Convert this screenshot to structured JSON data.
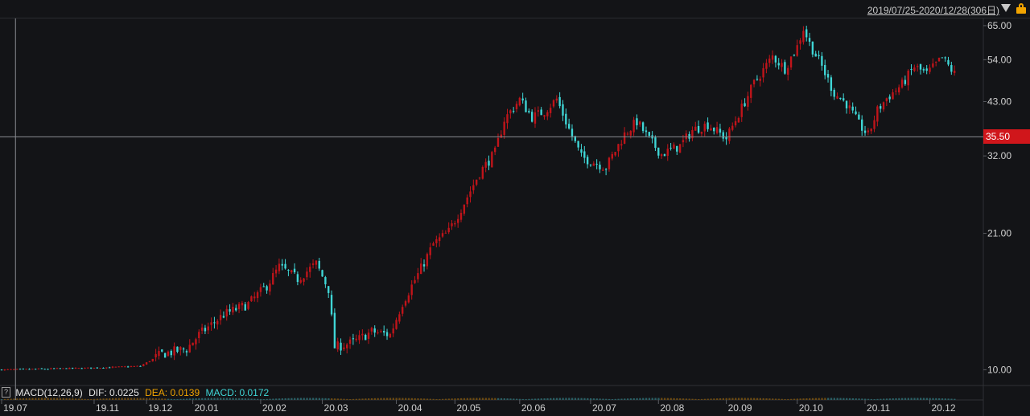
{
  "header": {
    "range_label": "2019/07/25-2020/12/28(306日)",
    "dropdown_icon": "triangle-down-icon",
    "lock_icon": "lock-icon"
  },
  "indicator": {
    "name": "MACD(12,26,9)",
    "dif_label": "DIF: 0.0225",
    "dea_label": "DEA: 0.0139",
    "macd_label": "MACD: 0.0172",
    "colors": {
      "dif": "#e6e6e6",
      "dea": "#f2a400",
      "macd": "#3fd6d6"
    }
  },
  "crosshair": {
    "price_label": "35.50",
    "price": 35.5,
    "date": "19.08"
  },
  "colors": {
    "up": "#c0141a",
    "down": "#3fd6d6",
    "axis_text": "#d0d0d0",
    "background": "#131417",
    "price_tag": "#d0161b"
  },
  "chart_data": {
    "type": "candlestick",
    "yscale": "log",
    "ylim": [
      9.3,
      67
    ],
    "yticks": [
      65.0,
      54.0,
      43.0,
      32.0,
      21.0,
      10.0
    ],
    "ytick_labels": [
      "65.00",
      "54.00",
      "43.00",
      "32.00",
      "21.00",
      "10.00"
    ],
    "xticks": [
      "19.07",
      "19.11",
      "19.12",
      "20.01",
      "20.02",
      "20.03",
      "20.04",
      "20.05",
      "20.06",
      "20.07",
      "20.08",
      "20.09",
      "20.10",
      "20.11",
      "20.12"
    ],
    "xtick_positions": [
      0,
      30,
      47,
      62,
      84,
      104,
      128,
      147,
      168,
      191,
      213,
      235,
      258,
      280,
      301
    ],
    "bars": 310,
    "price_path": [
      [
        0,
        10.0
      ],
      [
        30,
        10.1
      ],
      [
        45,
        10.2
      ],
      [
        52,
        10.9
      ],
      [
        60,
        11.2
      ],
      [
        64,
        12.1
      ],
      [
        72,
        13.5
      ],
      [
        80,
        14.3
      ],
      [
        86,
        15.8
      ],
      [
        90,
        17.5
      ],
      [
        96,
        16.4
      ],
      [
        102,
        17.8
      ],
      [
        106,
        15.5
      ],
      [
        108,
        11.3
      ],
      [
        114,
        11.6
      ],
      [
        120,
        12.3
      ],
      [
        126,
        12.1
      ],
      [
        130,
        14.4
      ],
      [
        135,
        16.8
      ],
      [
        140,
        19.8
      ],
      [
        145,
        21.2
      ],
      [
        150,
        24.8
      ],
      [
        155,
        29.2
      ],
      [
        160,
        32.6
      ],
      [
        163,
        39.0
      ],
      [
        168,
        43.5
      ],
      [
        172,
        39.5
      ],
      [
        176,
        40.8
      ],
      [
        180,
        43.6
      ],
      [
        184,
        37.0
      ],
      [
        188,
        31.8
      ],
      [
        196,
        30.1
      ],
      [
        202,
        36.0
      ],
      [
        206,
        38.6
      ],
      [
        210,
        35.0
      ],
      [
        214,
        32.3
      ],
      [
        220,
        33.8
      ],
      [
        224,
        36.8
      ],
      [
        229,
        38.0
      ],
      [
        235,
        35.2
      ],
      [
        239,
        40.2
      ],
      [
        244,
        47.5
      ],
      [
        250,
        55.0
      ],
      [
        254,
        51.5
      ],
      [
        258,
        58.0
      ],
      [
        260,
        64.0
      ],
      [
        262,
        59.0
      ],
      [
        266,
        52.0
      ],
      [
        270,
        45.0
      ],
      [
        274,
        42.5
      ],
      [
        278,
        38.0
      ],
      [
        281,
        35.8
      ],
      [
        284,
        41.0
      ],
      [
        287,
        43.8
      ],
      [
        292,
        47.2
      ],
      [
        296,
        52.0
      ],
      [
        300,
        50.0
      ],
      [
        305,
        54.5
      ],
      [
        309,
        50.0
      ]
    ]
  }
}
